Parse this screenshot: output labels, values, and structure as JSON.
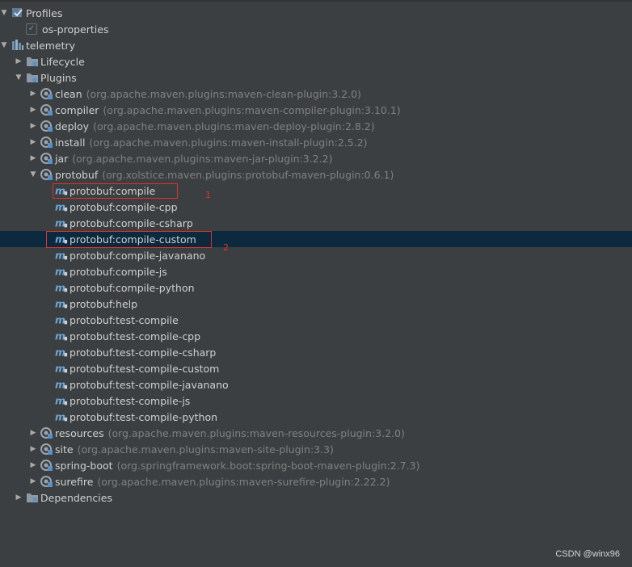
{
  "tree": [
    {
      "label": "Profiles",
      "arrow": "down",
      "icon": "profiles-icon",
      "indent": 0
    },
    {
      "label": "os-properties",
      "checkbox": true,
      "indent": 1
    },
    {
      "label": "telemetry",
      "arrow": "down",
      "icon": "maven-project-icon",
      "indent": 0
    },
    {
      "label": "Lifecycle",
      "arrow": "right",
      "icon": "lifecycle-folder-icon",
      "indent": 1
    },
    {
      "label": "Plugins",
      "arrow": "down",
      "icon": "plugins-folder-icon",
      "indent": 1
    },
    {
      "label": "clean",
      "coord": "(org.apache.maven.plugins:maven-clean-plugin:3.2.0)",
      "arrow": "right",
      "icon": "plugin-icon",
      "indent": 2
    },
    {
      "label": "compiler",
      "coord": "(org.apache.maven.plugins:maven-compiler-plugin:3.10.1)",
      "arrow": "right",
      "icon": "plugin-icon",
      "indent": 2
    },
    {
      "label": "deploy",
      "coord": "(org.apache.maven.plugins:maven-deploy-plugin:2.8.2)",
      "arrow": "right",
      "icon": "plugin-icon",
      "indent": 2
    },
    {
      "label": "install",
      "coord": "(org.apache.maven.plugins:maven-install-plugin:2.5.2)",
      "arrow": "right",
      "icon": "plugin-icon",
      "indent": 2
    },
    {
      "label": "jar",
      "coord": "(org.apache.maven.plugins:maven-jar-plugin:3.2.2)",
      "arrow": "right",
      "icon": "plugin-icon",
      "indent": 2
    },
    {
      "label": "protobuf",
      "coord": "(org.xolstice.maven.plugins:protobuf-maven-plugin:0.6.1)",
      "arrow": "down",
      "icon": "plugin-icon",
      "indent": 2
    },
    {
      "label": "protobuf:compile",
      "icon": "goal-icon",
      "indent": 3
    },
    {
      "label": "protobuf:compile-cpp",
      "icon": "goal-icon",
      "indent": 3
    },
    {
      "label": "protobuf:compile-csharp",
      "icon": "goal-icon",
      "indent": 3
    },
    {
      "label": "protobuf:compile-custom",
      "icon": "goal-icon",
      "indent": 3,
      "selected": true
    },
    {
      "label": "protobuf:compile-javanano",
      "icon": "goal-icon",
      "indent": 3
    },
    {
      "label": "protobuf:compile-js",
      "icon": "goal-icon",
      "indent": 3
    },
    {
      "label": "protobuf:compile-python",
      "icon": "goal-icon",
      "indent": 3
    },
    {
      "label": "protobuf:help",
      "icon": "goal-icon",
      "indent": 3
    },
    {
      "label": "protobuf:test-compile",
      "icon": "goal-icon",
      "indent": 3
    },
    {
      "label": "protobuf:test-compile-cpp",
      "icon": "goal-icon",
      "indent": 3
    },
    {
      "label": "protobuf:test-compile-csharp",
      "icon": "goal-icon",
      "indent": 3
    },
    {
      "label": "protobuf:test-compile-custom",
      "icon": "goal-icon",
      "indent": 3
    },
    {
      "label": "protobuf:test-compile-javanano",
      "icon": "goal-icon",
      "indent": 3
    },
    {
      "label": "protobuf:test-compile-js",
      "icon": "goal-icon",
      "indent": 3
    },
    {
      "label": "protobuf:test-compile-python",
      "icon": "goal-icon",
      "indent": 3
    },
    {
      "label": "resources",
      "coord": "(org.apache.maven.plugins:maven-resources-plugin:3.2.0)",
      "arrow": "right",
      "icon": "plugin-icon",
      "indent": 2
    },
    {
      "label": "site",
      "coord": "(org.apache.maven.plugins:maven-site-plugin:3.3)",
      "arrow": "right",
      "icon": "plugin-icon",
      "indent": 2
    },
    {
      "label": "spring-boot",
      "coord": "(org.springframework.boot:spring-boot-maven-plugin:2.7.3)",
      "arrow": "right",
      "icon": "plugin-icon",
      "indent": 2
    },
    {
      "label": "surefire",
      "coord": "(org.apache.maven.plugins:maven-surefire-plugin:2.22.2)",
      "arrow": "right",
      "icon": "plugin-icon",
      "indent": 2
    },
    {
      "label": "Dependencies",
      "arrow": "right",
      "icon": "dependencies-folder-icon",
      "indent": 1
    }
  ],
  "annotations": [
    {
      "number": "1",
      "target": "protobuf:compile"
    },
    {
      "number": "2",
      "target": "protobuf:compile-custom"
    }
  ],
  "watermark": "CSDN @winx96",
  "colors": {
    "background": "#3c3f41",
    "selected": "#0d293e",
    "annotation": "#e0322b",
    "coord": "#808080"
  }
}
